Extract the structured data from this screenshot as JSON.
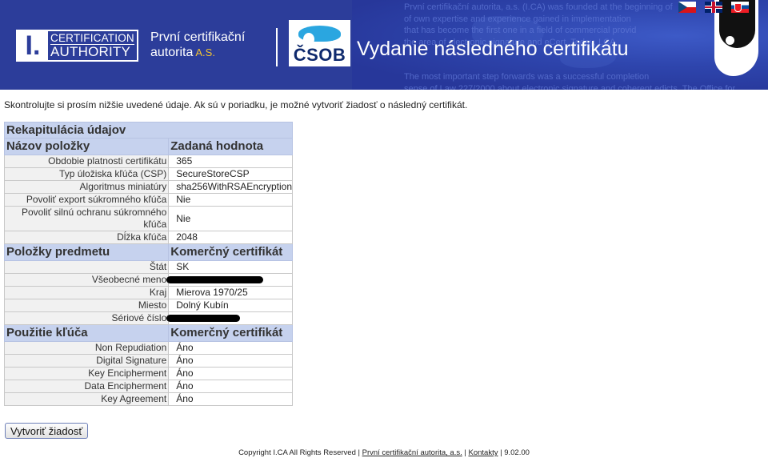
{
  "header": {
    "ca_logo_mark": "I.",
    "ca_logo_line1": "CERTIFICATION",
    "ca_logo_line2": "AUTHORITY",
    "company_line1": "První certifikační",
    "company_line2": "autorita",
    "company_suffix": "A.S.",
    "bank_logo": "ČSOB",
    "title": "Vydanie následného certifikátu",
    "background_text": [
      "První certifikační autorita, a.s. (I.CA) was founded at the beginning of",
      "of own expertise and experience gained in implementation",
      "that has become the first one in a field of commercial provid",
      "the area of electronic signature and eCert. Today, I.CA",
      "The most important step forwards was a successful completion",
      "sense of Law 227/2000 about electronic signature and coherent edicts, The Office for"
    ],
    "flags": [
      "cz-flag-icon",
      "gb-flag-icon",
      "sk-flag-icon"
    ],
    "colors": {
      "banner": "#2c3d9a",
      "accent": "#f1c232",
      "section_header": "#c6d2ee"
    }
  },
  "intro": "Skontrolujte si prosím nižšie uvedené údaje. Ak sú v poriadku, je možné vytvoriť žiadosť o následný certifikát.",
  "table": {
    "caption": "Rekapitulácia údajov",
    "general": {
      "col_name": "Názov položky",
      "col_value": "Zadaná hodnota",
      "rows": [
        {
          "k": "Obdobie platnosti certifikátu",
          "v": "365"
        },
        {
          "k": "Typ úložiska kľúča (CSP)",
          "v": "SecureStoreCSP"
        },
        {
          "k": "Algoritmus miniatúry",
          "v": "sha256WithRSAEncryption"
        },
        {
          "k": "Povoliť export súkromného kľúča",
          "v": "Nie"
        },
        {
          "k": "Povoliť silnú ochranu súkromného kľúča",
          "v": "Nie"
        },
        {
          "k": "Dĺžka kľúča",
          "v": "2048"
        }
      ]
    },
    "subject": {
      "col_name": "Položky predmetu",
      "col_value": "Komerčný certifikát",
      "rows": [
        {
          "k": "Štát",
          "v": "SK"
        },
        {
          "k": "Všeobecné meno",
          "v": ""
        },
        {
          "k": "Kraj",
          "v": "Mierova 1970/25"
        },
        {
          "k": "Miesto",
          "v": "Dolný Kubín"
        },
        {
          "k": "Sériové číslo",
          "v": ""
        }
      ]
    },
    "usage": {
      "col_name": "Použitie kľúča",
      "col_value": "Komerčný certifikát",
      "rows": [
        {
          "k": "Non Repudiation",
          "v": "Áno"
        },
        {
          "k": "Digital Signature",
          "v": "Áno"
        },
        {
          "k": "Key Encipherment",
          "v": "Áno"
        },
        {
          "k": "Data Encipherment",
          "v": "Áno"
        },
        {
          "k": "Key Agreement",
          "v": "Áno"
        }
      ]
    }
  },
  "button_label": "Vytvoriť žiadosť",
  "footer": {
    "copyright": "Copyright I.CA All Rights Reserved | ",
    "link_company": "První certifikační autorita, a.s.",
    "sep": " | ",
    "link_contacts": "Kontakty",
    "version": " | 9.02.00"
  }
}
